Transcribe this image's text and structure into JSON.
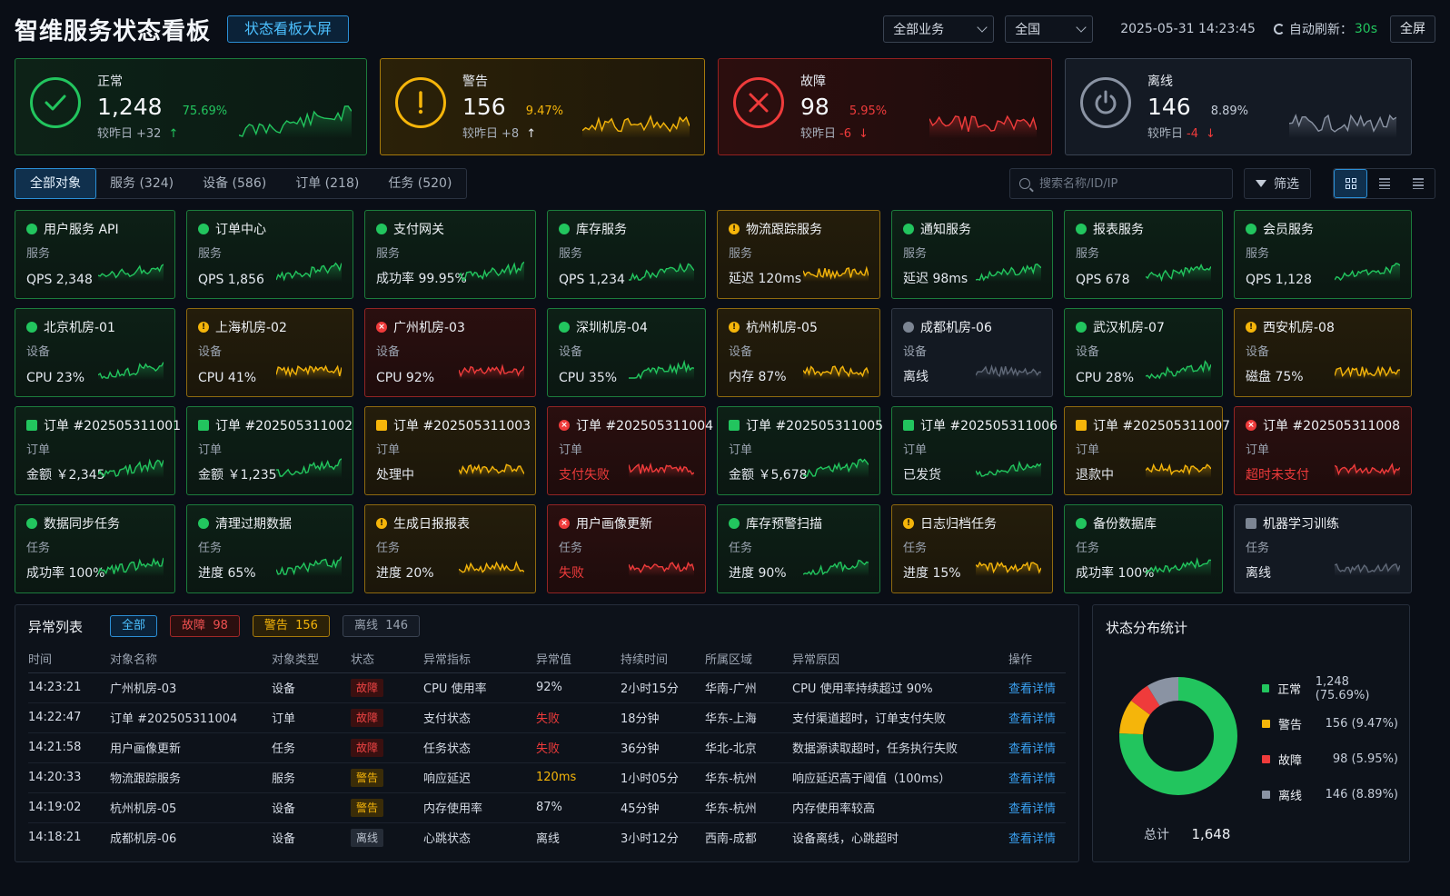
{
  "header": {
    "title": "智维服务状态看板",
    "screen_button": "状态看板大屏",
    "business_select": "全部业务",
    "region_select": "全国",
    "datetime": "2025-05-31 14:23:45",
    "refresh_label": "自动刷新：",
    "refresh_value": "30s",
    "fullscreen": "全屏"
  },
  "summary": [
    {
      "status": "ok",
      "label": "正常",
      "count": "1,248",
      "pct": "75.69%",
      "cmp_label": "较昨日",
      "delta": "+32",
      "arrow": "up",
      "color": "#22c55e"
    },
    {
      "status": "warn",
      "label": "警告",
      "count": "156",
      "pct": "9.47%",
      "cmp_label": "较昨日",
      "delta": "+8",
      "arrow": "up",
      "color": "#f5b50a"
    },
    {
      "status": "err",
      "label": "故障",
      "count": "98",
      "pct": "5.95%",
      "cmp_label": "较昨日",
      "delta": "-6",
      "arrow": "down",
      "color": "#ef3b3b"
    },
    {
      "status": "off",
      "label": "离线",
      "count": "146",
      "pct": "8.89%",
      "cmp_label": "较昨日",
      "delta": "-4",
      "arrow": "down",
      "color": "#8a93a3"
    }
  ],
  "tabs": [
    "全部对象",
    "服务 (324)",
    "设备 (586)",
    "订单 (218)",
    "任务 (520)"
  ],
  "search": {
    "placeholder": "搜索名称/ID/IP"
  },
  "filter_label": "筛选",
  "objects": [
    {
      "status": "ok",
      "name": "用户服务 API",
      "type": "服务",
      "metric": "QPS 2,348"
    },
    {
      "status": "ok",
      "name": "订单中心",
      "type": "服务",
      "metric": "QPS 1,856"
    },
    {
      "status": "ok",
      "name": "支付网关",
      "type": "服务",
      "metric": "成功率 99.95%"
    },
    {
      "status": "ok",
      "name": "库存服务",
      "type": "服务",
      "metric": "QPS 1,234"
    },
    {
      "status": "warn",
      "name": "物流跟踪服务",
      "type": "服务",
      "metric": "延迟 120ms"
    },
    {
      "status": "ok",
      "name": "通知服务",
      "type": "服务",
      "metric": "延迟 98ms"
    },
    {
      "status": "ok",
      "name": "报表服务",
      "type": "服务",
      "metric": "QPS 678"
    },
    {
      "status": "ok",
      "name": "会员服务",
      "type": "服务",
      "metric": "QPS 1,128"
    },
    {
      "status": "ok",
      "name": "北京机房-01",
      "type": "设备",
      "metric": "CPU 23%"
    },
    {
      "status": "warn",
      "name": "上海机房-02",
      "type": "设备",
      "metric": "CPU 41%"
    },
    {
      "status": "err",
      "name": "广州机房-03",
      "type": "设备",
      "metric": "CPU 92%"
    },
    {
      "status": "ok",
      "name": "深圳机房-04",
      "type": "设备",
      "metric": "CPU 35%"
    },
    {
      "status": "warn",
      "name": "杭州机房-05",
      "type": "设备",
      "metric": "内存 87%"
    },
    {
      "status": "off",
      "name": "成都机房-06",
      "type": "设备",
      "metric": "离线"
    },
    {
      "status": "ok",
      "name": "武汉机房-07",
      "type": "设备",
      "metric": "CPU 28%"
    },
    {
      "status": "warn",
      "name": "西安机房-08",
      "type": "设备",
      "metric": "磁盘 75%"
    },
    {
      "status": "ok",
      "name": "订单 #202505311001",
      "type": "订单",
      "metric": "金额 ￥2,345"
    },
    {
      "status": "ok",
      "name": "订单 #202505311002",
      "type": "订单",
      "metric": "金额 ￥1,235"
    },
    {
      "status": "warn",
      "name": "订单 #202505311003",
      "type": "订单",
      "metric": "处理中"
    },
    {
      "status": "err",
      "name": "订单 #202505311004",
      "type": "订单",
      "metric": "支付失败"
    },
    {
      "status": "ok",
      "name": "订单 #202505311005",
      "type": "订单",
      "metric": "金额 ￥5,678"
    },
    {
      "status": "ok",
      "name": "订单 #202505311006",
      "type": "订单",
      "metric": "已发货"
    },
    {
      "status": "warn",
      "name": "订单 #202505311007",
      "type": "订单",
      "metric": "退款中"
    },
    {
      "status": "err",
      "name": "订单 #202505311008",
      "type": "订单",
      "metric": "超时未支付"
    },
    {
      "status": "ok",
      "name": "数据同步任务",
      "type": "任务",
      "metric": "成功率 100%"
    },
    {
      "status": "ok",
      "name": "清理过期数据",
      "type": "任务",
      "metric": "进度 65%"
    },
    {
      "status": "warn",
      "name": "生成日报报表",
      "type": "任务",
      "metric": "进度 20%"
    },
    {
      "status": "err",
      "name": "用户画像更新",
      "type": "任务",
      "metric": "失败"
    },
    {
      "status": "ok",
      "name": "库存预警扫描",
      "type": "任务",
      "metric": "进度 90%"
    },
    {
      "status": "warn",
      "name": "日志归档任务",
      "type": "任务",
      "metric": "进度 15%"
    },
    {
      "status": "ok",
      "name": "备份数据库",
      "type": "任务",
      "metric": "成功率 100%"
    },
    {
      "status": "off",
      "name": "机器学习训练",
      "type": "任务",
      "metric": "离线"
    }
  ],
  "anomaly": {
    "title": "异常列表",
    "chips": {
      "all": "全部",
      "err_label": "故障",
      "err_count": "98",
      "warn_label": "警告",
      "warn_count": "156",
      "off_label": "离线",
      "off_count": "146"
    },
    "columns": [
      "时间",
      "对象名称",
      "对象类型",
      "状态",
      "异常指标",
      "异常值",
      "持续时间",
      "所属区域",
      "异常原因",
      "操作"
    ],
    "rows": [
      {
        "time": "14:23:21",
        "name": "广州机房-03",
        "type": "设备",
        "status": "故障",
        "level": "err",
        "metric": "CPU 使用率",
        "value": "92%",
        "value_tone": "",
        "duration": "2小时15分",
        "region": "华南-广州",
        "reason": "CPU 使用率持续超过 90%",
        "action": "查看详情"
      },
      {
        "time": "14:22:47",
        "name": "订单 #202505311004",
        "type": "订单",
        "status": "故障",
        "level": "err",
        "metric": "支付状态",
        "value": "失败",
        "value_tone": "red",
        "duration": "18分钟",
        "region": "华东-上海",
        "reason": "支付渠道超时，订单支付失败",
        "action": "查看详情"
      },
      {
        "time": "14:21:58",
        "name": "用户画像更新",
        "type": "任务",
        "status": "故障",
        "level": "err",
        "metric": "任务状态",
        "value": "失败",
        "value_tone": "red",
        "duration": "36分钟",
        "region": "华北-北京",
        "reason": "数据源读取超时，任务执行失败",
        "action": "查看详情"
      },
      {
        "time": "14:20:33",
        "name": "物流跟踪服务",
        "type": "服务",
        "status": "警告",
        "level": "warn",
        "metric": "响应延迟",
        "value": "120ms",
        "value_tone": "amber",
        "duration": "1小时05分",
        "region": "华东-杭州",
        "reason": "响应延迟高于阈值（100ms）",
        "action": "查看详情"
      },
      {
        "time": "14:19:02",
        "name": "杭州机房-05",
        "type": "设备",
        "status": "警告",
        "level": "warn",
        "metric": "内存使用率",
        "value": "87%",
        "value_tone": "",
        "duration": "45分钟",
        "region": "华东-杭州",
        "reason": "内存使用率较高",
        "action": "查看详情"
      },
      {
        "time": "14:18:21",
        "name": "成都机房-06",
        "type": "设备",
        "status": "离线",
        "level": "off",
        "metric": "心跳状态",
        "value": "离线",
        "value_tone": "",
        "duration": "3小时12分",
        "region": "西南-成都",
        "reason": "设备离线，心跳超时",
        "action": "查看详情"
      }
    ]
  },
  "distribution": {
    "title": "状态分布统计",
    "items": [
      {
        "name": "正常",
        "value": "1,248 (75.69%)",
        "share": 75.69,
        "color": "#22c55e"
      },
      {
        "name": "警告",
        "value": "156 (9.47%)",
        "share": 9.47,
        "color": "#f5b50a"
      },
      {
        "name": "故障",
        "value": "98 (5.95%)",
        "share": 5.95,
        "color": "#ef3b3b"
      },
      {
        "name": "离线",
        "value": "146 (8.89%)",
        "share": 8.89,
        "color": "#8a93a3"
      }
    ],
    "total_label": "总计",
    "total_value": "1,648"
  }
}
